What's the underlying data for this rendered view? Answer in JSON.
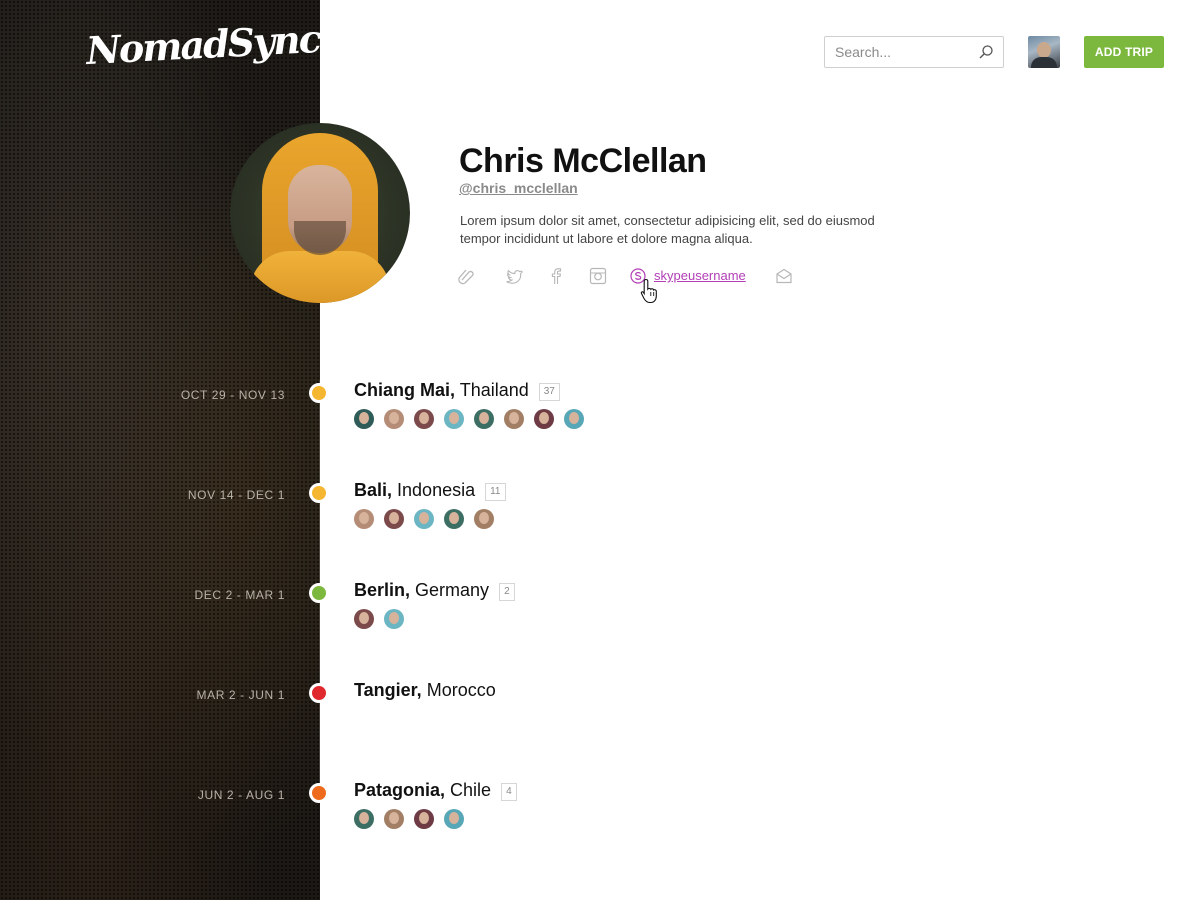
{
  "brand": {
    "logo_text": "NomadSync"
  },
  "header": {
    "search_placeholder": "Search...",
    "add_trip_label": "ADD TRIP"
  },
  "profile": {
    "name": "Chris McClellan",
    "handle": "@chris_mcclellan",
    "bio": "Lorem ipsum dolor sit amet, consectetur adipisicing elit, sed do eiusmod tempor incididunt ut labore et dolore magna aliqua.",
    "social": {
      "icons": [
        "link-icon",
        "twitter-icon",
        "facebook-icon",
        "instagram-icon",
        "skype-icon",
        "mail-icon"
      ],
      "skype_username": "skypeusername",
      "skype_color": "#b23fb6"
    }
  },
  "trips": [
    {
      "dates": "OCT 29 - NOV 13",
      "city": "Chiang Mai,",
      "country": "Thailand",
      "count": "37",
      "dot_color": "#f5b731",
      "people": 8
    },
    {
      "dates": "NOV 14 - DEC 1",
      "city": "Bali,",
      "country": "Indonesia",
      "count": "11",
      "dot_color": "#f5b731",
      "people": 5
    },
    {
      "dates": "DEC 2 - MAR 1",
      "city": "Berlin,",
      "country": "Germany",
      "count": "2",
      "dot_color": "#7cb83e",
      "people": 2
    },
    {
      "dates": "MAR 2 - JUN 1",
      "city": "Tangier,",
      "country": "Morocco",
      "count": "",
      "dot_color": "#e0282f",
      "people": 0
    },
    {
      "dates": "JUN 2 - AUG 1",
      "city": "Patagonia,",
      "country": "Chile",
      "count": "4",
      "dot_color": "#ee6a1c",
      "people": 4
    }
  ],
  "colors": {
    "accent_green": "#7cb83e",
    "panel_dark": "#1e1b17"
  }
}
